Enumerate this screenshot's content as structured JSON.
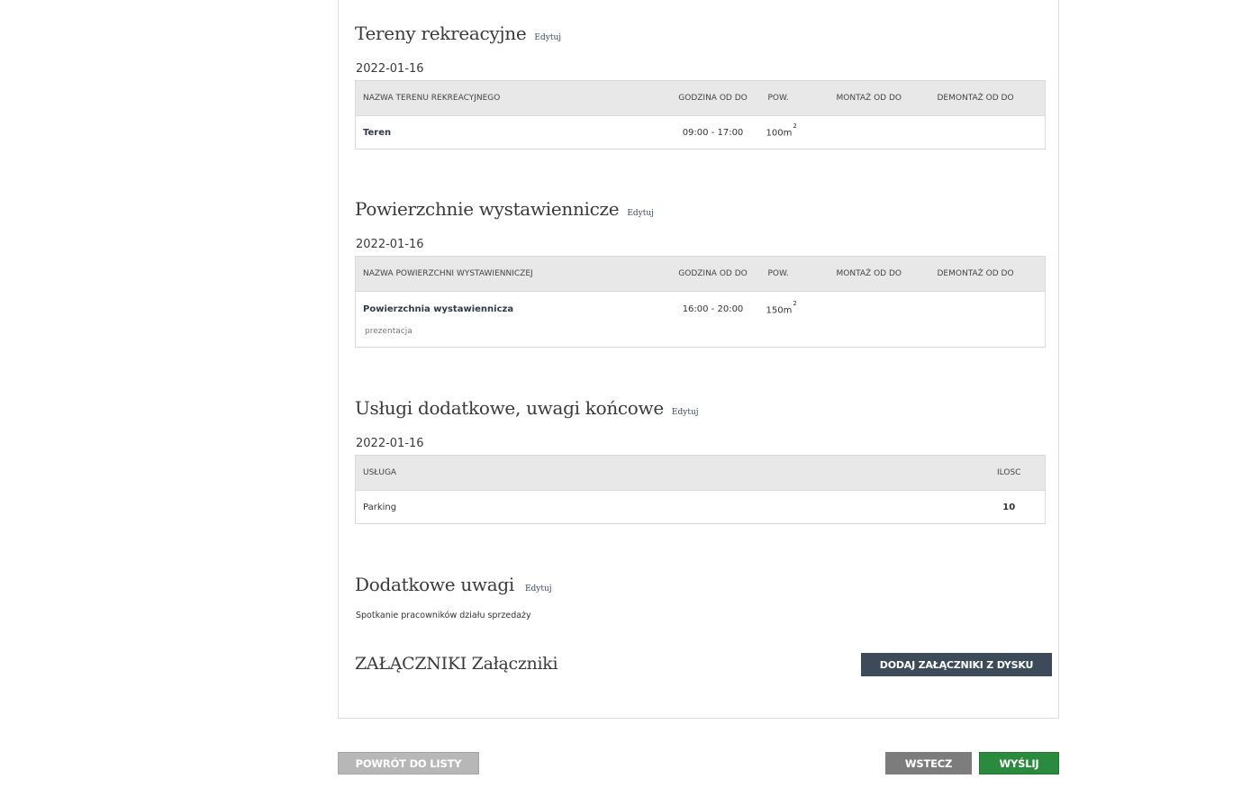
{
  "edit_label": "Edytuj",
  "recreational": {
    "title": "Tereny rekreacyjne",
    "date": "2022-01-16",
    "columns": [
      "NAZWA TERENU REKREACYJNEGO",
      "GODZINA OD DO",
      "POW.",
      "MONTAŻ OD DO",
      "DEMONTAŻ OD DO"
    ],
    "rows": [
      {
        "name": "Teren",
        "hours": "09:00 - 17:00",
        "area": "100m",
        "area_unit_sup": "2",
        "mount": "",
        "dismount": ""
      }
    ]
  },
  "exhibition": {
    "title": "Powierzchnie wystawiennicze",
    "date": "2022-01-16",
    "columns": [
      "NAZWA POWIERZCHNI WYSTAWIENNICZEJ",
      "GODZINA OD DO",
      "POW.",
      "MONTAŻ OD DO",
      "DEMONTAŻ OD DO"
    ],
    "rows": [
      {
        "name": "Powierzchnia wystawiennicza",
        "hours": "16:00 - 20:00",
        "area": "150m",
        "area_unit_sup": "2",
        "mount": "",
        "dismount": "",
        "note": "prezentacja"
      }
    ]
  },
  "services": {
    "title": "Usługi dodatkowe, uwagi końcowe",
    "date": "2022-01-16",
    "columns": [
      "USŁUGA",
      "ILOSC"
    ],
    "rows": [
      {
        "service": "Parking",
        "qty": "10"
      }
    ]
  },
  "notes": {
    "title": "Dodatkowe uwagi",
    "text": "Spotkanie pracowników działu sprzedaży"
  },
  "attachments": {
    "title": "ZAŁĄCZNIKI Załączniki",
    "add_button": "DODAJ ZAŁĄCZNIKI Z DYSKU"
  },
  "footer": {
    "back_to_list": "POWRÓT DO LISTY",
    "previous": "WSTECZ",
    "send": "WYŚLIJ"
  },
  "colors": {
    "dark_button": "#3d4a59",
    "send_button": "#2a8a3e",
    "prev_button": "#7c7c7c",
    "back_button": "#b7b7b7"
  }
}
